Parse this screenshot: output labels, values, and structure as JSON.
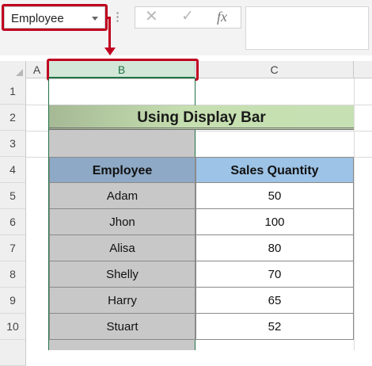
{
  "name_box": {
    "value": "Employee"
  },
  "formula_bar": {
    "cancel_icon": "✕",
    "enter_icon": "✓",
    "fx_label": "fx"
  },
  "columns": [
    {
      "label": "A"
    },
    {
      "label": "B"
    },
    {
      "label": "C"
    }
  ],
  "rows": [
    "1",
    "2",
    "3",
    "4",
    "5",
    "6",
    "7",
    "8",
    "9",
    "10"
  ],
  "sheet": {
    "title": "Using Display Bar",
    "headers": {
      "employee": "Employee",
      "sales": "Sales Quantity"
    },
    "records": [
      {
        "name": "Adam",
        "qty": "50"
      },
      {
        "name": "Jhon",
        "qty": "100"
      },
      {
        "name": "Alisa",
        "qty": "80"
      },
      {
        "name": "Shelly",
        "qty": "70"
      },
      {
        "name": "Harry",
        "qty": "65"
      },
      {
        "name": "Stuart",
        "qty": "52"
      }
    ]
  },
  "colors": {
    "highlight": "#c00020",
    "selection_border": "#217346",
    "header_fill": "#9dc3e6",
    "title_fill": "#c6e0b4"
  }
}
